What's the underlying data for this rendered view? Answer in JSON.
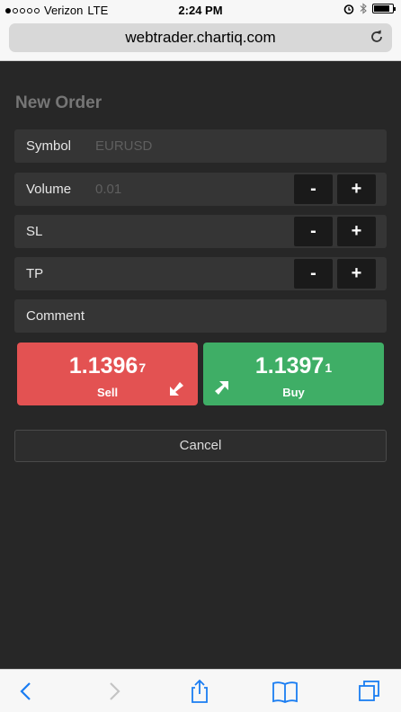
{
  "status": {
    "carrier": "Verizon",
    "network": "LTE",
    "time": "2:24 PM"
  },
  "browser": {
    "url": "webtrader.chartiq.com"
  },
  "order": {
    "title": "New Order",
    "symbol_label": "Symbol",
    "symbol_value": "EURUSD",
    "volume_label": "Volume",
    "volume_value": "0.01",
    "sl_label": "SL",
    "tp_label": "TP",
    "comment_label": "Comment",
    "minus": "-",
    "plus": "+",
    "sell": {
      "price_main": "1.1396",
      "price_pip": "7",
      "label": "Sell",
      "color": "#e35252"
    },
    "buy": {
      "price_main": "1.1397",
      "price_pip": "1",
      "label": "Buy",
      "color": "#3fae66"
    },
    "cancel_label": "Cancel"
  },
  "colors": {
    "background": "#272727",
    "row": "#353535",
    "ios_blue": "#1a7df2"
  }
}
